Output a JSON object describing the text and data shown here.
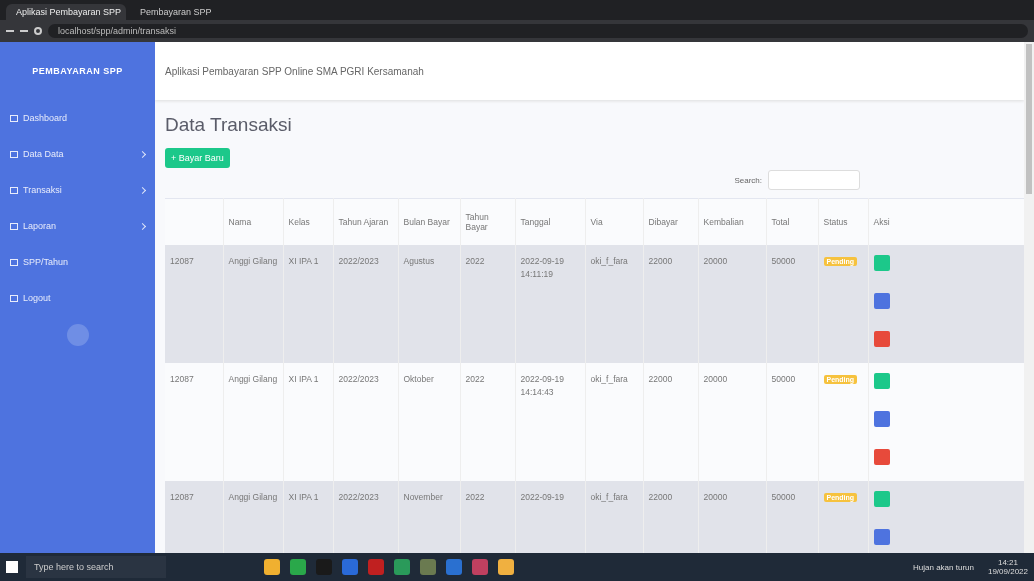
{
  "browser": {
    "tabs": [
      {
        "title": "Aplikasi Pembayaran SPP",
        "selected": true
      },
      {
        "title": "Pembayaran SPP",
        "selected": false
      }
    ],
    "url": "localhost/spp/admin/transaksi"
  },
  "sidebar": {
    "brand": "PEMBAYARAN SPP",
    "items": [
      {
        "label": "Dashboard",
        "expandable": false
      },
      {
        "label": "Data Data",
        "expandable": true
      },
      {
        "label": "Transaksi",
        "expandable": true
      },
      {
        "label": "Laporan",
        "expandable": true
      },
      {
        "label": "SPP/Tahun",
        "expandable": false
      },
      {
        "label": "Logout",
        "expandable": false
      }
    ]
  },
  "topbar": {
    "title": "Aplikasi Pembayaran SPP Online SMA PGRI Kersamanah"
  },
  "page": {
    "heading": "Data Transaksi",
    "add_button": "+ Bayar Baru",
    "search_label": "Search:"
  },
  "table": {
    "columns": [
      "",
      "Nama",
      "Kelas",
      "Tahun Ajaran",
      "Bulan Bayar",
      "Tahun Bayar",
      "Tanggal",
      "Via",
      "Dibayar",
      "Kembalian",
      "Total",
      "Status",
      "Aksi"
    ],
    "rows": [
      {
        "cells": [
          "12087",
          "Anggi Gilang",
          "XI IPA 1",
          "2022/2023",
          "Agustus",
          "2022",
          "2022-09-19 14:11:19",
          "oki_f_fara",
          "22000",
          "20000",
          "50000"
        ],
        "status": "Pending",
        "shaded": true
      },
      {
        "cells": [
          "12087",
          "Anggi Gilang",
          "XI IPA 1",
          "2022/2023",
          "Oktober",
          "2022",
          "2022-09-19 14:14:43",
          "oki_f_fara",
          "22000",
          "20000",
          "50000"
        ],
        "status": "Pending",
        "shaded": false
      },
      {
        "cells": [
          "12087",
          "Anggi Gilang",
          "XI IPA 1",
          "2022/2023",
          "November",
          "2022",
          "2022-09-19",
          "oki_f_fara",
          "22000",
          "20000",
          "50000"
        ],
        "status": "Pending",
        "shaded": true
      }
    ]
  },
  "taskbar": {
    "search_placeholder": "Type here to search",
    "weather": "Hujan akan turun",
    "time": "14:21",
    "date": "19/09/2022"
  }
}
